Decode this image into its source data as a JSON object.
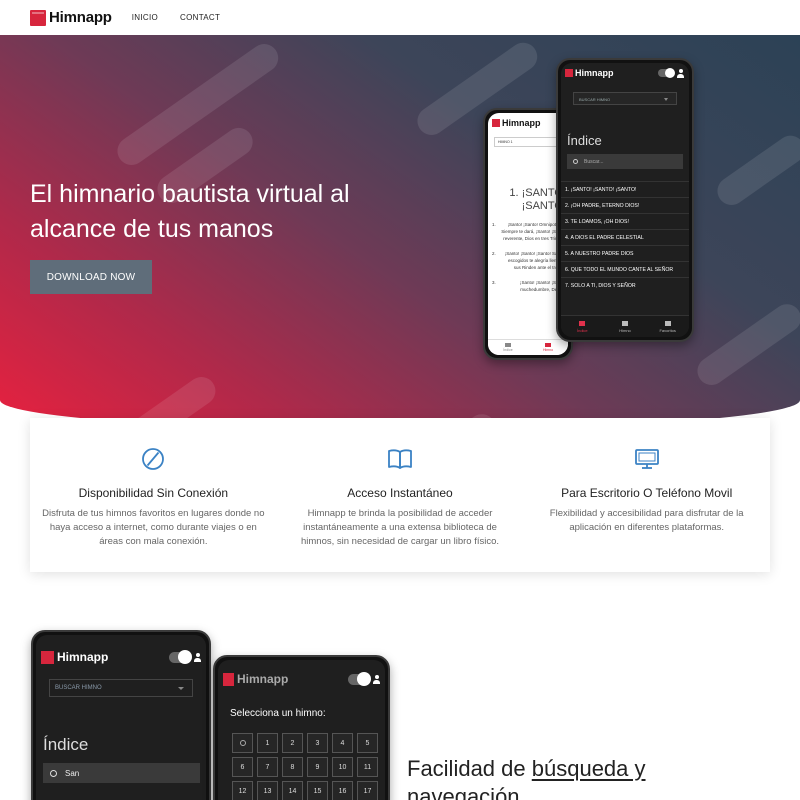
{
  "navbar": {
    "brand": "Himnapp",
    "links": [
      "INICIO",
      "CONTACT"
    ]
  },
  "hero": {
    "title": "El himnario bautista virtual al alcance de tus manos",
    "download_label": "DOWNLOAD NOW"
  },
  "hero_phone_dark": {
    "brand": "Himnapp",
    "select_placeholder": "BUSCAR HIMNO",
    "indice_label": "Índice",
    "search_placeholder": "Buscar...",
    "hymns": [
      "1. ¡SANTO! ¡SANTO! ¡SANTO!",
      "2. ¡OH PADRE, ETERNO DIOS!",
      "3. TE LOAMOS, ¡OH DIOS!",
      "4. A DIOS EL PADRE CELESTIAL",
      "5. A NUESTRO PADRE DIOS",
      "6. QUE TODO EL MUNDO CANTE AL SEÑOR",
      "7. SOLO A TI, DIOS Y SEÑOR"
    ],
    "tabs": [
      "Índice",
      "Himno",
      "Favoritos"
    ]
  },
  "hero_phone_light": {
    "brand": "Himnapp",
    "select_value": "HIMNO 1",
    "hymn_title": "1. ¡SANTO! ¡SANTO!",
    "verses": [
      {
        "num": "1.",
        "text": "¡Santo! ¡Santo! Omnipotente, Siempre te dará, ¡Santo! ¡Santo! reverente, Dios en tres Trinidad"
      },
      {
        "num": "2.",
        "text": "¡Santo! ¡Santo! ¡Santo! Santos escogidos te alegría llenos, y sus Rinden ante el trono y"
      },
      {
        "num": "3.",
        "text": "¡Santo! ¡Santo! ¡Santo! muchedumbre, De áng"
      }
    ],
    "tabs": [
      "Índice",
      "Himno"
    ]
  },
  "features": [
    {
      "icon": "slash-circle-icon",
      "title": "Disponibilidad Sin Conexión",
      "desc": "Disfruta de tus himnos favoritos en lugares donde no haya acceso a internet, como durante viajes o en áreas con mala conexión."
    },
    {
      "icon": "open-book-icon",
      "title": "Acceso Instantáneo",
      "desc": "Himnapp te brinda la posibilidad de acceder instantáneamente a una extensa biblioteca de himnos, sin necesidad de cargar un libro físico."
    },
    {
      "icon": "monitor-icon",
      "title": "Para Escritorio O Teléfono Movil",
      "desc": "Flexibilidad y accesibilidad para disfrutar de la aplicación en diferentes plataformas."
    }
  ],
  "section2": {
    "phone_big": {
      "brand": "Himnapp",
      "select_placeholder": "BUSCAR HIMNO",
      "indice_label": "Índice",
      "search_value": "San"
    },
    "phone_grid": {
      "brand": "Himnapp",
      "label": "Selecciona un himno:",
      "numbers": [
        "1",
        "2",
        "3",
        "4",
        "5",
        "6",
        "7",
        "8",
        "9",
        "10",
        "11",
        "12",
        "13",
        "14",
        "15",
        "16",
        "17"
      ]
    },
    "title_prefix": "Facilidad de ",
    "title_underlined": "búsqueda y",
    "title_line2": "navegación"
  },
  "colors": {
    "brand_red": "#d7263d",
    "hero_gradient_start": "#e8213f",
    "hero_gradient_end": "#2c4256",
    "button_gray": "#5f6d7a",
    "icon_blue": "#3b82c4"
  }
}
